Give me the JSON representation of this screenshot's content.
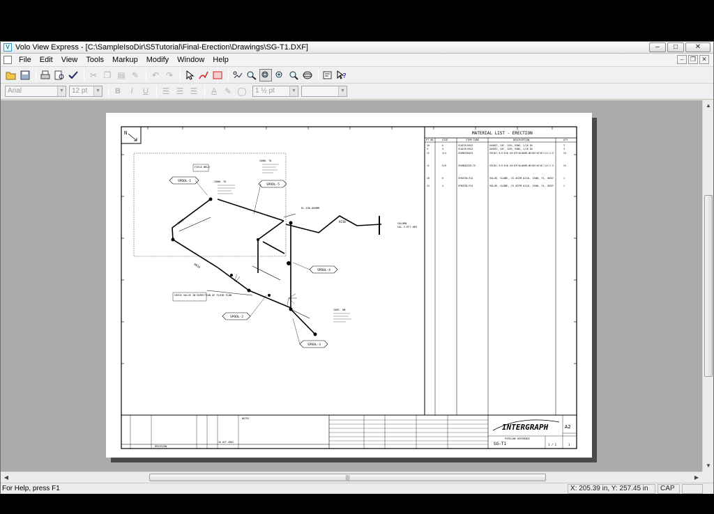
{
  "window": {
    "title": "Volo View Express - [C:\\SampleIsoDir\\S5Tutorial\\Final-Erection\\Drawings\\SG-T1.DXF]"
  },
  "menu": [
    "File",
    "Edit",
    "View",
    "Tools",
    "Markup",
    "Modify",
    "Window",
    "Help"
  ],
  "format": {
    "font": "Arial",
    "size": "12 pt",
    "line_width": "1 ½ pt"
  },
  "drawing": {
    "north": "N",
    "spools": [
      "SPOOL-1",
      "SPOOL-5",
      "SPOOL-4",
      "SPOOL-2",
      "SPOOL-3"
    ],
    "labels": {
      "field_weld": "FIELD WELD",
      "check_valve": "CHECK VALVE IN DIRECTION OF FLUID FLOW",
      "column": "COLUMN",
      "column_ref": "COL V-EFT-003",
      "el": "EL 436,000MM",
      "conn_to": "CONN. TO",
      "cont_on": "CONT. ON",
      "dim_a": "2508",
      "dim_b": "6028",
      "dim_c": "9210"
    },
    "bom": {
      "title": "MATERIAL LIST - ERECTION",
      "headers": [
        "PT NO",
        "SIZE",
        "ITEM CODE",
        "DESCRIPTION",
        "QTY"
      ],
      "rows": [
        [
          "10",
          "6",
          "SCAICB-HSSZ",
          "GASKET, CAF, 125%, RING, 1/16 IN",
          "3"
        ],
        [
          "9",
          "4",
          "SCAICB-HSSZ",
          "GASKET, CAF, 125%, RING, 1/16 IN",
          "3"
        ],
        [
          "11",
          "3/4",
          "ZSSMA755A25",
          "STUD BOLT, DS GT OR WD, EACH WITH TWO WASHERS AND HEAVY HEX NUT 8 3/4 X 4.25",
          "24"
        ],
        [
          "11",
          "5/8",
          "ZSSMA6J5X3.75",
          "STUD BOLT, DS GT OR WD, EACH WITH TWO WASHERS AND HEAVY HEX NUT 2 5/8 X 3.75",
          "24"
        ],
        [
          "18",
          "6",
          "VYKGF30-FLD",
          "VALVE, GLOBE, CS ASTM A216, 150#, FL, 0057",
          "1"
        ],
        [
          "13",
          "4",
          "VYKGF30-FLD",
          "VALVE, GLOBE, CS ASTM A216, 150#, FL, 0057",
          "1"
        ]
      ]
    },
    "title_block": {
      "logo": "INTERGRAPH",
      "sheet": "SG-T1",
      "size": "A2",
      "rev": "1",
      "sheet_no": "1 / 1",
      "date": "26 OCT 2003",
      "revision_header": "REVISION",
      "notes_header": "NOTES",
      "piping_ref": "PIPELINE REFERENCE"
    }
  },
  "status": {
    "help": "For Help, press F1",
    "coords": "X: 205.39 in, Y: 257.45 in",
    "cap": "CAP"
  }
}
